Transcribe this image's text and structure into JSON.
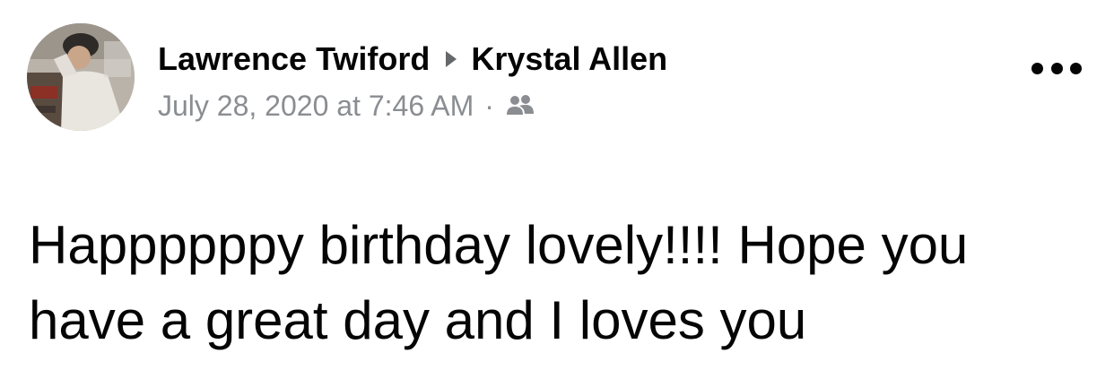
{
  "post": {
    "author": "Lawrence Twiford",
    "recipient": "Krystal Allen",
    "timestamp": "July 28, 2020 at 7:46 AM",
    "separator": "·",
    "audience_icon": "friends-icon",
    "more_icon": "more-options-icon",
    "text": "Happppppy birthday lovely!!!! Hope you have a great day and I loves you"
  }
}
